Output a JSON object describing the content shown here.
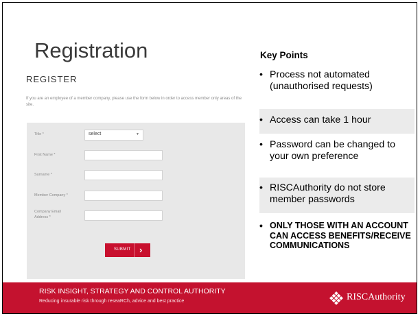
{
  "slide": {
    "title": "Registration"
  },
  "form": {
    "heading": "REGISTER",
    "intro": "If you are an employee of a member company, please use the form below in order to access member only areas of the site.",
    "fields": [
      {
        "label": "Title *",
        "type": "select",
        "value": "select"
      },
      {
        "label": "First Name *",
        "type": "text",
        "value": ""
      },
      {
        "label": "Surname *",
        "type": "text",
        "value": ""
      },
      {
        "label": "Member Company *",
        "type": "text",
        "value": ""
      },
      {
        "label": "Company Email Address *",
        "type": "text",
        "value": ""
      }
    ],
    "submit_label": "SUBMIT",
    "submit_arrow": "›",
    "select_arrow": "▼"
  },
  "key_points": {
    "heading": "Key Points",
    "bullet": "•",
    "items": [
      {
        "text": "Process not automated (unauthorised requests)"
      },
      {
        "text": "Access can take 1 hour"
      },
      {
        "text": "Password can be changed to your own preference"
      },
      {
        "text": "RISCAuthority do not store member passwords"
      },
      {
        "text": "ONLY THOSE WITH AN ACCOUNT CAN ACCESS BENEFITS/RECEIVE COMMUNICATIONS"
      }
    ]
  },
  "footer": {
    "line1": "RISK INSIGHT, STRATEGY AND CONTROL AUTHORITY",
    "line2": "Reducing insurable risk through reseaRCh, advice and best practice",
    "brand": "RISCAuthority",
    "logo_icon": "diamond-grid-logo"
  },
  "colors": {
    "accent": "#c4122f",
    "panel": "#e8e8e8"
  }
}
